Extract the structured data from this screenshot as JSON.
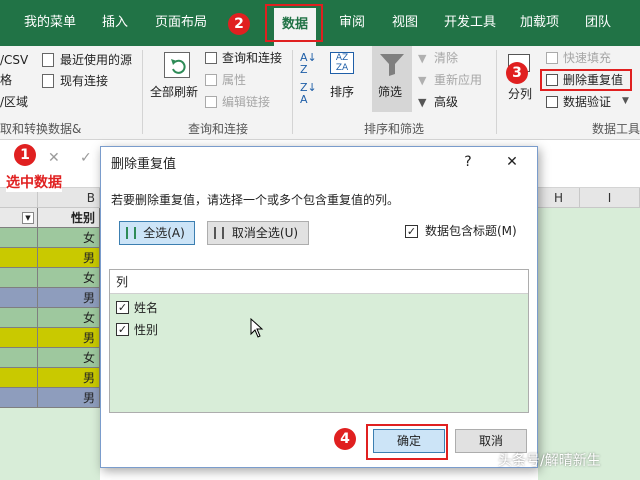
{
  "ribbon_tabs": [
    "我的菜单",
    "插入",
    "页面布局",
    "数据",
    "审阅",
    "视图",
    "开发工具",
    "加载项",
    "团队"
  ],
  "ribbon": {
    "get_data": {
      "csv": "/CSV",
      "table": "格",
      "range": "/区域",
      "group_label": "取和转换数据&"
    },
    "recent_sources": "最近使用的源",
    "existing_conn": "现有连接",
    "refresh_all": "全部刷新",
    "queries_conn": "查询和连接",
    "properties": "属性",
    "edit_links": "编辑链接",
    "group_queries": "查询和连接",
    "sort": "排序",
    "filter": "筛选",
    "clear": "清除",
    "reapply": "重新应用",
    "advanced": "高级",
    "group_sort": "排序和筛选",
    "split": "分列",
    "flash_fill": "快速填充",
    "remove_dup": "删除重复值",
    "data_validation": "数据验证",
    "group_tools": "数据工具"
  },
  "sheet": {
    "col_b": "B",
    "col_h": "H",
    "col_i": "I",
    "header_gender": "性别",
    "genders": [
      "女",
      "男",
      "女",
      "男",
      "女",
      "男",
      "女",
      "男",
      "男"
    ]
  },
  "dialog": {
    "title": "删除重复值",
    "help": "?",
    "close": "✕",
    "instruction": "若要删除重复值，请选择一个或多个包含重复值的列。",
    "select_all": "全选(A)",
    "unselect_all": "取消全选(U)",
    "has_headers": "数据包含标题(M)",
    "list_header": "列",
    "columns": [
      "姓名",
      "性别"
    ],
    "ok": "确定",
    "cancel": "取消"
  },
  "annotations": {
    "step1": "1",
    "step1_text": "选中数据",
    "step2": "2",
    "step3": "3",
    "step4": "4"
  },
  "watermark": "头条号/解晴新生",
  "colors": {
    "ribbon_green": "#217346",
    "annotation_red": "#e02020",
    "row_yellow": "#c9c900",
    "row_blue": "#8e9dbd",
    "row_green": "#9ec89e"
  }
}
